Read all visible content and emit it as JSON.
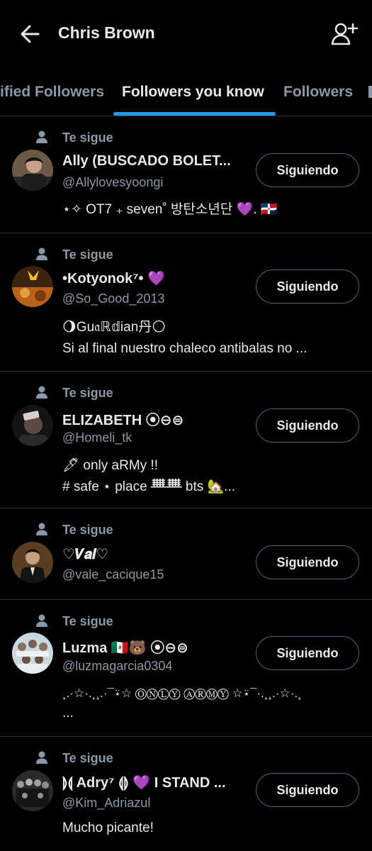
{
  "header": {
    "title": "Chris Brown"
  },
  "tabs": [
    {
      "label": "ified Followers"
    },
    {
      "label": "Followers you know"
    },
    {
      "label": "Followers"
    }
  ],
  "colors": {
    "accent": "#1d9bf0",
    "muted": "#8b98a5",
    "border": "#2f3336"
  },
  "follows_label": "Te sigue",
  "button_label": "Siguiendo",
  "followers": [
    {
      "name": "Ally (BUSCADO BOLET...",
      "handle": "@Allylovesyoongi",
      "bio": [
        "⋆✧ OT7 ₊ seven˚ 방탄소년단 💜. 🇩🇴"
      ]
    },
    {
      "name": "•Kotyonok⁷• 💜",
      "handle": "@So_Good_2013",
      "bio": [
        "🌖Gu𝔞ℝ𝕕ian丹🌕",
        "Si al final nuestro chaleco antibalas no ..."
      ]
    },
    {
      "name": "ELIZABETH ⦿⊖⊜",
      "handle": "@Homeli_tk",
      "bio": [
        "🖋 only aRMy !!",
        "# safe ⋆ place ᚙᚙ bts 🏡..."
      ]
    },
    {
      "name": "♡𝑽𝒂𝒍♡",
      "handle": "@vale_cacique15",
      "bio": []
    },
    {
      "name": "Luzma 🇲🇽🐻 ⦿⊖⊜",
      "handle": "@luzmagarcia0304",
      "bio": [
        "¸.·☆·.¸¸.·¯⍣☆ ⓄⓃⓁⓎ ⒶⓇⓂⓎ ☆⍣¯·.¸¸.·☆·.¸",
        "..."
      ]
    },
    {
      "name": "⟭⟬ Adry⁷ ⟬⟭ 💜 I STAND ...",
      "handle": "@Kim_Adriazul",
      "bio": [
        "Mucho picante!"
      ]
    }
  ]
}
